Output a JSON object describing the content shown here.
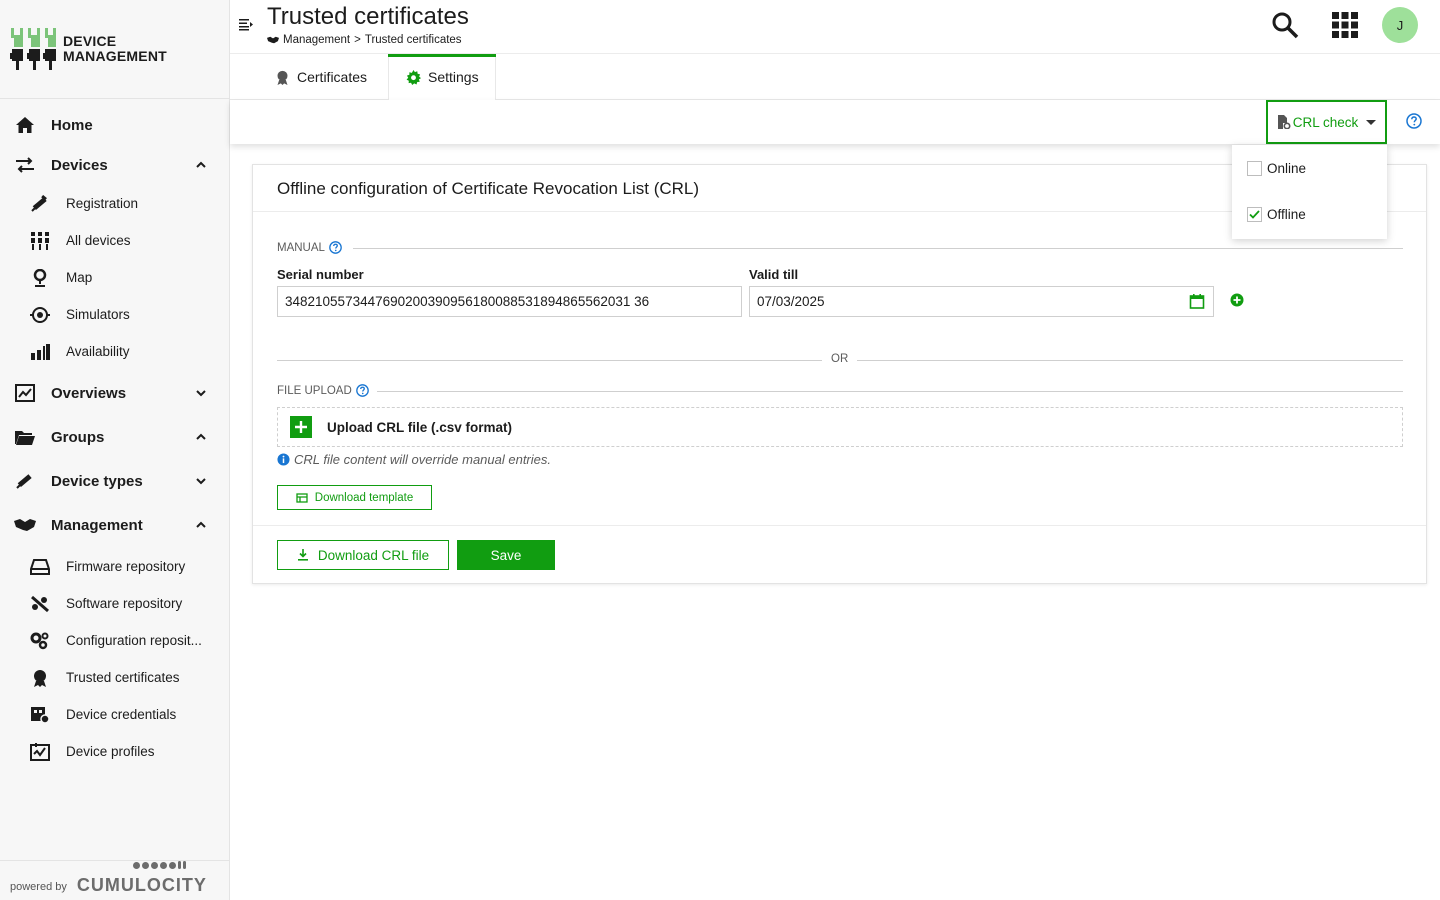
{
  "brand": {
    "line1": "DEVICE",
    "line2": "MANAGEMENT"
  },
  "sidebar": {
    "home": "Home",
    "devices": "Devices",
    "devices_children": {
      "registration": "Registration",
      "all_devices": "All devices",
      "map": "Map",
      "simulators": "Simulators",
      "availability": "Availability"
    },
    "overviews": "Overviews",
    "groups": "Groups",
    "device_types": "Device types",
    "management": "Management",
    "management_children": {
      "firmware": "Firmware repository",
      "software": "Software repository",
      "configuration": "Configuration reposit...",
      "trusted": "Trusted certificates",
      "credentials": "Device credentials",
      "profiles": "Device profiles"
    },
    "powered_by": "powered by",
    "cumulocity": "CUMULOCITY"
  },
  "header": {
    "title": "Trusted certificates",
    "breadcrumb": {
      "parent": "Management",
      "separator": ">",
      "current": "Trusted certificates"
    },
    "avatar_initial": "J"
  },
  "tabs": {
    "certificates": "Certificates",
    "settings": "Settings",
    "active": "settings"
  },
  "actionbar": {
    "crl_check": "CRL check"
  },
  "dropdown": {
    "online": "Online",
    "offline": "Offline",
    "online_checked": false,
    "offline_checked": true
  },
  "card": {
    "title": "Offline configuration of Certificate Revocation List (CRL)",
    "manual_legend": "MANUAL",
    "serial_label": "Serial number",
    "serial_value": "3482105573447690200390956180088531894865562031 36",
    "valid_label": "Valid till",
    "valid_value": "07/03/2025",
    "or": "OR",
    "file_upload_legend": "FILE UPLOAD",
    "upload_label": "Upload CRL file (.csv format)",
    "hint": "CRL file content will override manual entries.",
    "download_template": "Download template",
    "download_crl": "Download CRL file",
    "save": "Save"
  },
  "colors": {
    "accent": "#119d11",
    "avatar": "#9ee09a",
    "sidebar_bg": "#f7f7f7"
  }
}
